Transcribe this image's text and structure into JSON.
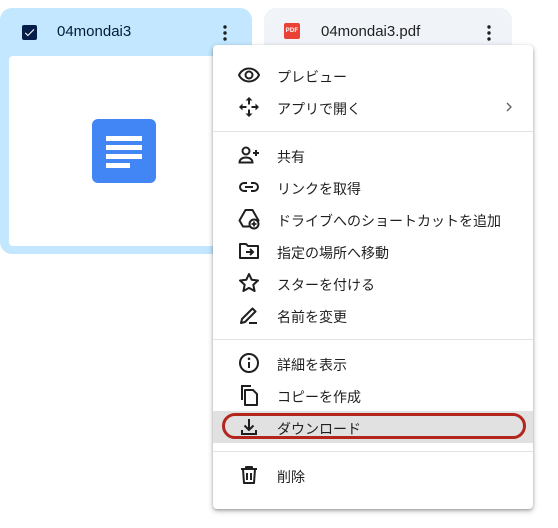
{
  "files": [
    {
      "name": "04mondai3",
      "selected": true,
      "type": "document"
    },
    {
      "name": "04mondai3.pdf",
      "selected": false,
      "type": "pdf",
      "type_badge": "PDF"
    }
  ],
  "menu": {
    "items": [
      {
        "label": "プレビュー",
        "icon": "eye-icon"
      },
      {
        "label": "アプリで開く",
        "icon": "open-with-icon",
        "submenu": true
      },
      {
        "label": "共有",
        "icon": "person-add-icon"
      },
      {
        "label": "リンクを取得",
        "icon": "link-icon"
      },
      {
        "label": "ドライブへのショートカットを追加",
        "icon": "drive-shortcut-icon"
      },
      {
        "label": "指定の場所へ移動",
        "icon": "move-folder-icon"
      },
      {
        "label": "スターを付ける",
        "icon": "star-icon"
      },
      {
        "label": "名前を変更",
        "icon": "pencil-icon"
      },
      {
        "label": "詳細を表示",
        "icon": "info-icon"
      },
      {
        "label": "コピーを作成",
        "icon": "copy-icon"
      },
      {
        "label": "ダウンロード",
        "icon": "download-icon",
        "highlighted": true
      },
      {
        "label": "削除",
        "icon": "trash-icon"
      }
    ]
  },
  "colors": {
    "selected_card": "#c2e7ff",
    "doc_icon": "#4285f4",
    "pdf_badge": "#ea4335",
    "annotation_ring": "#b3261e"
  }
}
